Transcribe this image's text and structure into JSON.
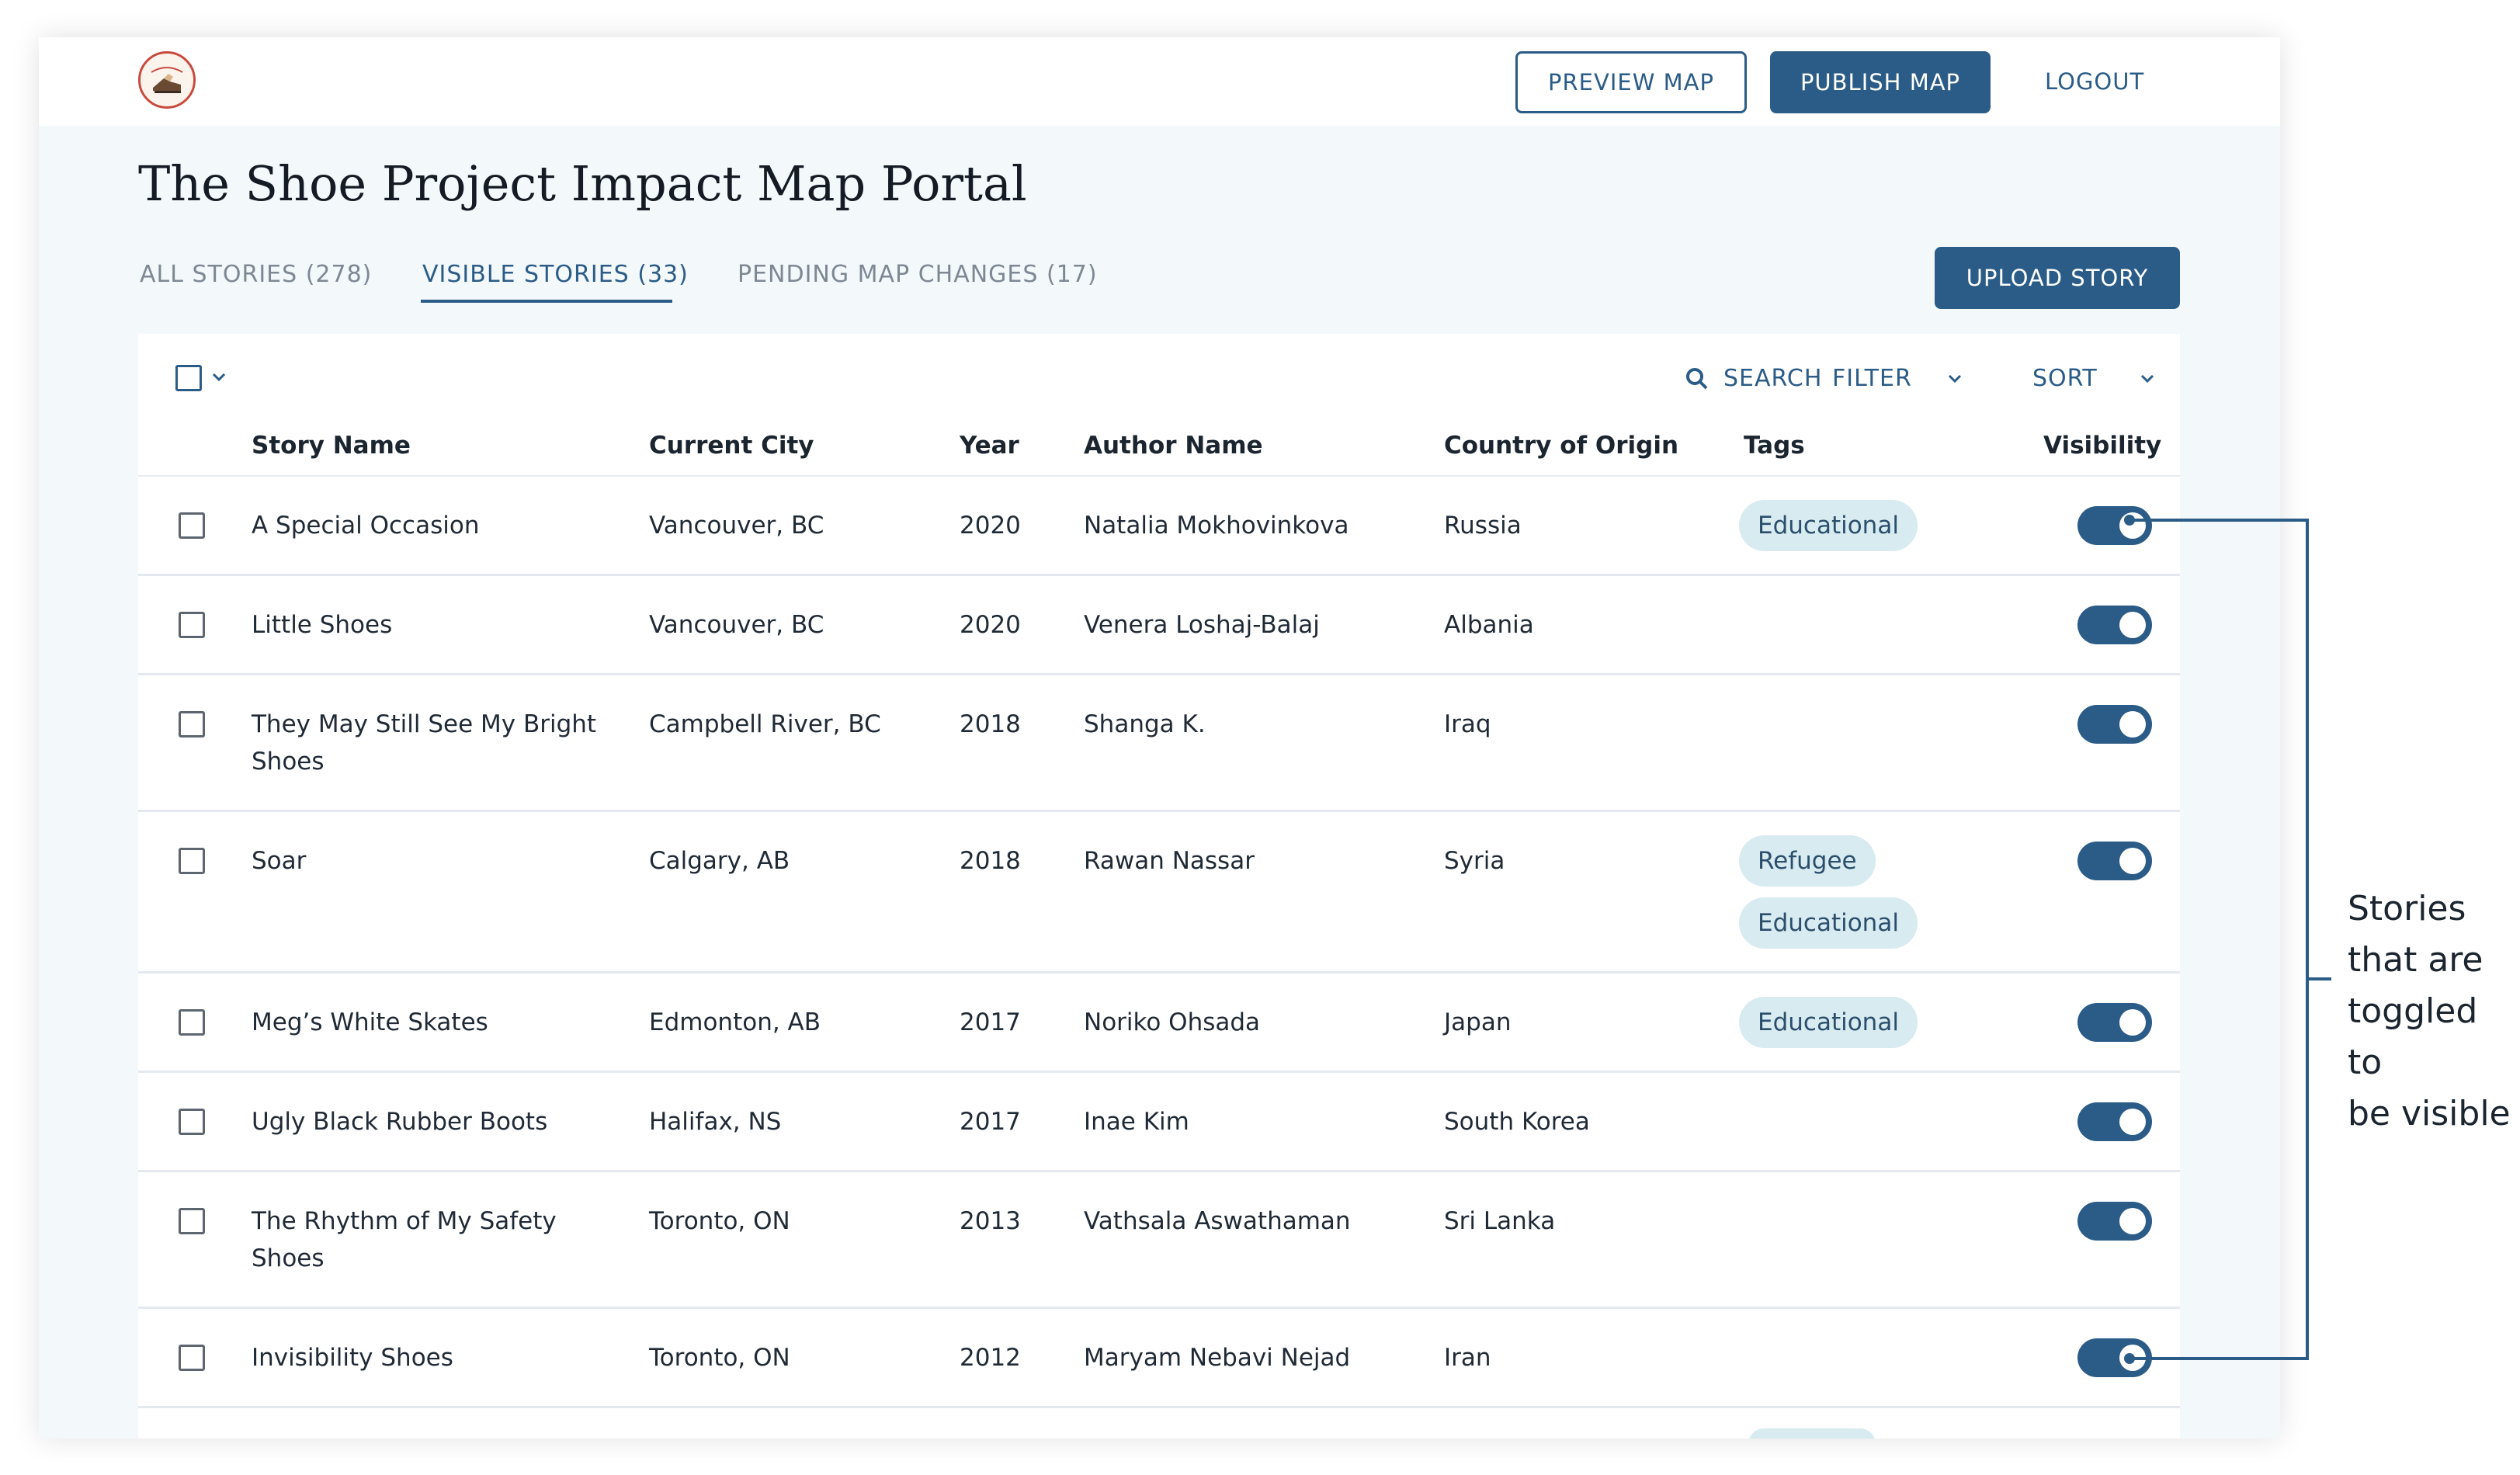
{
  "header": {
    "preview_label": "PREVIEW MAP",
    "publish_label": "PUBLISH MAP",
    "logout_label": "LOGOUT"
  },
  "page": {
    "title": "The Shoe Project Impact Map Portal"
  },
  "tabs": [
    {
      "label": "ALL STORIES (278)",
      "active": false
    },
    {
      "label": "VISIBLE STORIES (33)",
      "active": true
    },
    {
      "label": "PENDING MAP CHANGES (17)",
      "active": false
    }
  ],
  "actions": {
    "upload_label": "UPLOAD STORY"
  },
  "toolbar": {
    "search_label": "SEARCH",
    "filter_label": "FILTER",
    "sort_label": "SORT"
  },
  "columns": [
    "Story Name",
    "Current City",
    "Year",
    "Author Name",
    "Country of Origin",
    "Tags",
    "Visibility"
  ],
  "rows": [
    {
      "story_l1": "A Special Occasion",
      "story_l2": "",
      "city": "Vancouver, BC",
      "year": "2020",
      "author": "Natalia Mokhovinkova",
      "country": "Russia",
      "tag1": "Educational",
      "tag2": "",
      "visible": true
    },
    {
      "story_l1": "Little Shoes",
      "story_l2": "",
      "city": "Vancouver, BC",
      "year": "2020",
      "author": "Venera Loshaj-Balaj",
      "country": "Albania",
      "tag1": "",
      "tag2": "",
      "visible": true
    },
    {
      "story_l1": "They May Still See My Bright",
      "story_l2": "Shoes",
      "city": "Campbell River, BC",
      "year": "2018",
      "author": "Shanga K.",
      "country": "Iraq",
      "tag1": "",
      "tag2": "",
      "visible": true
    },
    {
      "story_l1": "Soar",
      "story_l2": "",
      "city": "Calgary, AB",
      "year": "2018",
      "author": "Rawan Nassar",
      "country": "Syria",
      "tag1": "Refugee",
      "tag2": "Educational",
      "visible": true
    },
    {
      "story_l1": "Meg’s White Skates",
      "story_l2": "",
      "city": "Edmonton, AB",
      "year": "2017",
      "author": "Noriko Ohsada",
      "country": "Japan",
      "tag1": "Educational",
      "tag2": "",
      "visible": true
    },
    {
      "story_l1": "Ugly Black Rubber Boots",
      "story_l2": "",
      "city": "Halifax, NS",
      "year": "2017",
      "author": "Inae Kim",
      "country": "South Korea",
      "tag1": "",
      "tag2": "",
      "visible": true
    },
    {
      "story_l1": "The Rhythm of My Safety",
      "story_l2": "Shoes",
      "city": "Toronto, ON",
      "year": "2013",
      "author": "Vathsala Aswathaman",
      "country": "Sri Lanka",
      "tag1": "",
      "tag2": "",
      "visible": true
    },
    {
      "story_l1": "Invisibility Shoes",
      "story_l2": "",
      "city": "Toronto, ON",
      "year": "2012",
      "author": "Maryam Nebavi Nejad",
      "country": "Iran",
      "tag1": "",
      "tag2": "",
      "visible": true
    }
  ],
  "annotation": {
    "line1": "Stories",
    "line2": "that are",
    "line3": "toggled to",
    "line4": "be visible"
  },
  "colors": {
    "primary": "#2b5c87",
    "tag_bg": "#d7ebf0",
    "page_bg": "#f3f8fb"
  }
}
